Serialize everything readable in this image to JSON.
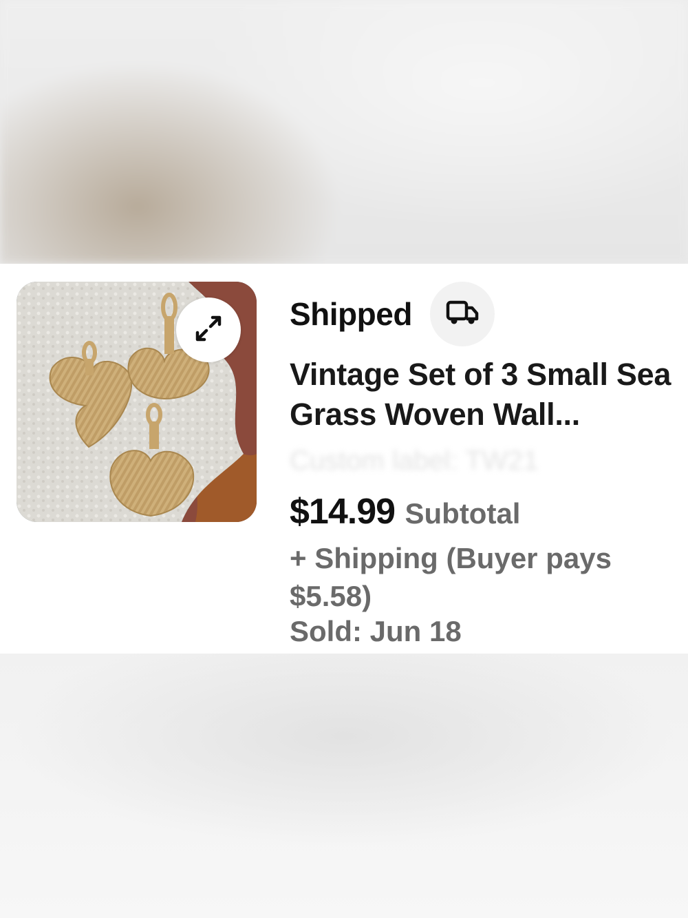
{
  "order": {
    "status": "Shipped",
    "title": "Vintage Set of 3 Small Sea Grass Woven Wall...",
    "custom_label": "Custom label: TW21",
    "price": "$14.99",
    "price_caption": "Subtotal",
    "shipping": "+ Shipping (Buyer pays $5.58)",
    "sold": "Sold: Jun 18"
  },
  "icons": {
    "expand": "expand-icon",
    "shipping": "truck-icon"
  },
  "colors": {
    "primary_text": "#111111",
    "secondary_text": "#6a6a6a",
    "card_bg": "#ffffff"
  }
}
